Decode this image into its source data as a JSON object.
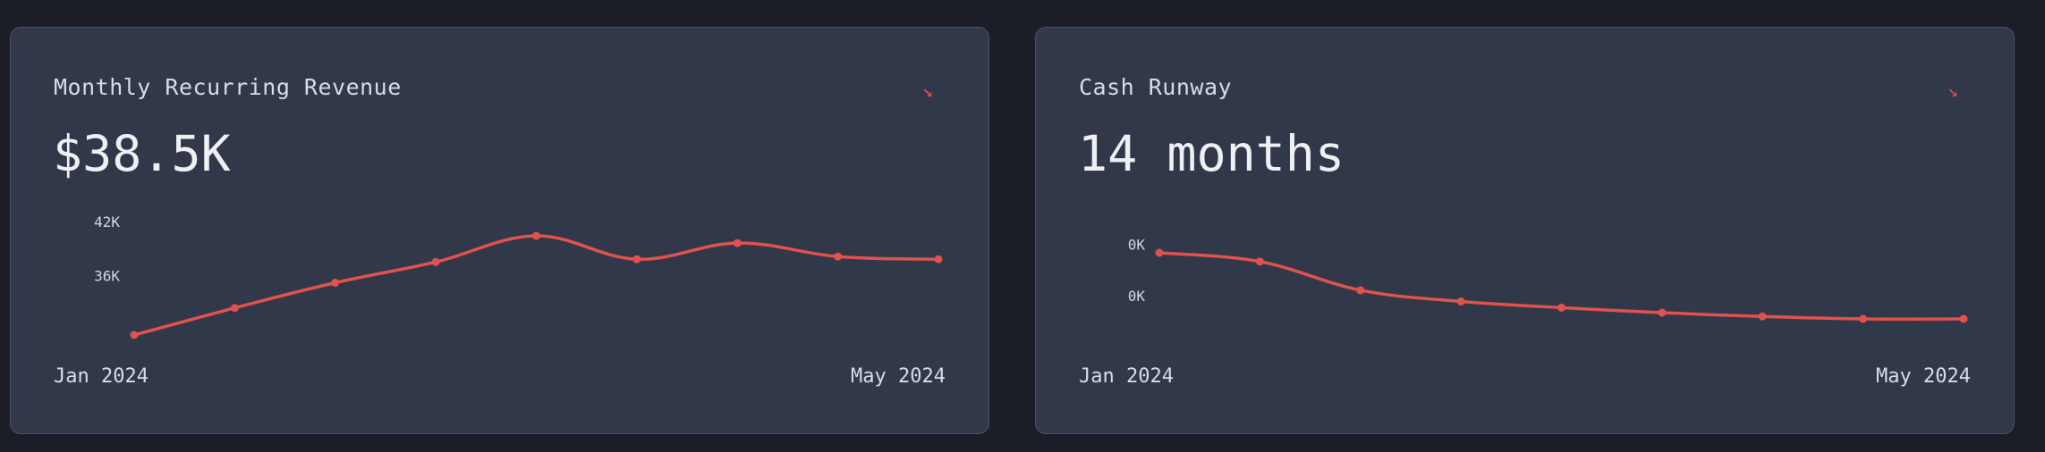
{
  "colors": {
    "background": "#1b1e26",
    "card": "#313849",
    "card_border": "#4a5366",
    "line": "#e0524d",
    "text": "#d8dce4"
  },
  "cards": [
    {
      "title": "Monthly Recurring Revenue",
      "value": "$38.5K",
      "trend_icon": "↘",
      "date_start": "Jan 2024",
      "date_end": "May 2024"
    },
    {
      "title": "Cash Runway",
      "value": "14 months",
      "trend_icon": "↘",
      "date_start": "Jan 2024",
      "date_end": "May 2024"
    }
  ],
  "chart_data": [
    {
      "type": "line",
      "title": "Monthly Recurring Revenue",
      "points": 9,
      "values": [
        29.5,
        32.5,
        35.3,
        37.6,
        40.5,
        37.9,
        39.7,
        38.2,
        37.9
      ],
      "y_ticks": [
        {
          "label": "42K",
          "value": 42
        },
        {
          "label": "36K",
          "value": 36
        }
      ],
      "x_start_label": "Jan 2024",
      "x_end_label": "May 2024",
      "line_color": "#e0524d",
      "grid": false
    },
    {
      "type": "line",
      "title": "Cash Runway",
      "points": 9,
      "values": [
        19.4,
        18.7,
        16.4,
        15.5,
        15.0,
        14.6,
        14.3,
        14.1,
        14.1
      ],
      "y_ticks": [
        {
          "label": "0K",
          "value": 20.0
        },
        {
          "label": "0K",
          "value": 15.9
        }
      ],
      "x_start_label": "Jan 2024",
      "x_end_label": "May 2024",
      "line_color": "#e0524d",
      "grid": false
    }
  ]
}
